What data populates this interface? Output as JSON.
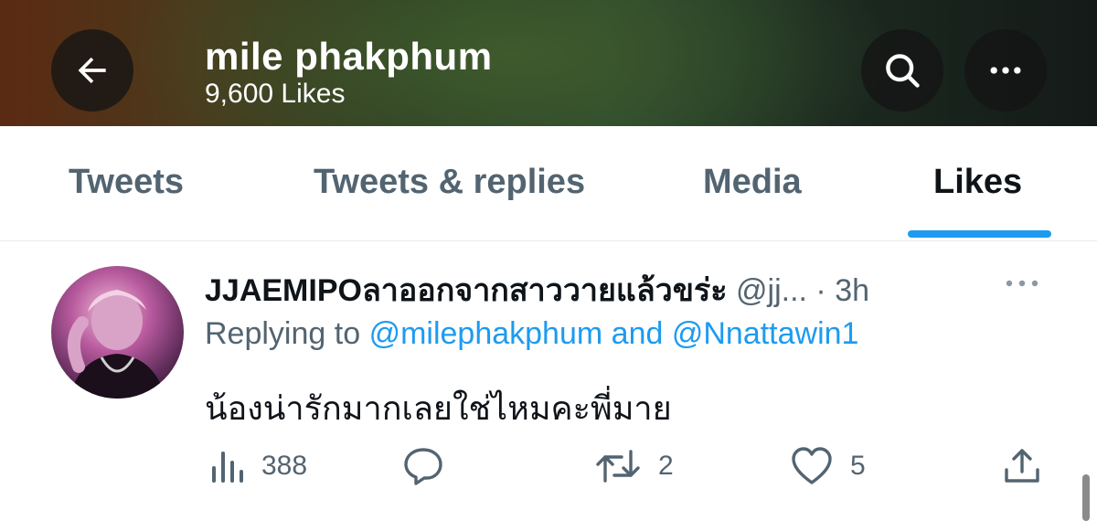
{
  "header": {
    "title": "mile phakphum",
    "subtitle": "9,600 Likes",
    "back_icon": "arrow-left-icon",
    "search_icon": "search-icon",
    "more_icon": "more-horizontal-icon"
  },
  "tabs": [
    {
      "label": "Tweets",
      "active": false
    },
    {
      "label": "Tweets & replies",
      "active": false
    },
    {
      "label": "Media",
      "active": false
    },
    {
      "label": "Likes",
      "active": true
    }
  ],
  "colors": {
    "accent": "#1d9bf0",
    "text_primary": "#0f1419",
    "text_secondary": "#536471"
  },
  "tweet": {
    "author_name": "JJAEMIPOลาออกจากสาววายแล้วขร่ะ",
    "author_handle": "@jj...",
    "time": "· 3h",
    "reply_prefix": "Replying to",
    "reply_mention_1": "@milephakphum",
    "reply_and": "and",
    "reply_mention_2": "@Nnattawin1",
    "text": "น้องน่ารักมากเลยใช่ไหมคะพี่มาย",
    "views": "388",
    "replies": "",
    "retweets": "2",
    "likes": "5",
    "icons": [
      "views-icon",
      "reply-icon",
      "retweet-icon",
      "heart-icon",
      "share-icon"
    ]
  }
}
